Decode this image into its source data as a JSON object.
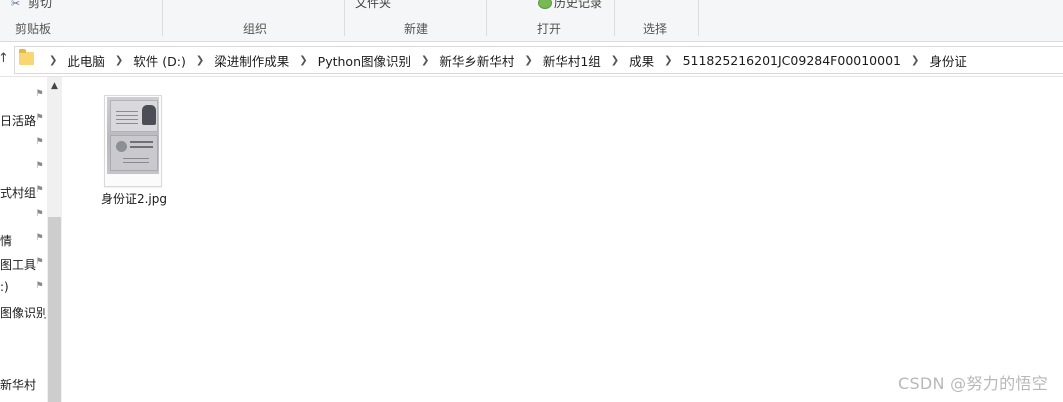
{
  "ribbon": {
    "cut_label": "剪切",
    "new_folder_label": "文件夹",
    "history_label": "历史记录",
    "groups": {
      "clipboard": "剪贴板",
      "organize": "组织",
      "new": "新建",
      "open": "打开",
      "select": "选择"
    }
  },
  "address_bar": {
    "breadcrumbs": [
      "此电脑",
      "软件 (D:)",
      "梁进制作成果",
      "Python图像识别",
      "新华乡新华村",
      "新华村1组",
      "成果",
      "511825216201JC09284F00010001",
      "身份证"
    ]
  },
  "nav_pane": {
    "items": [
      {
        "label": "",
        "pinned": true
      },
      {
        "label": "日活路",
        "pinned": true
      },
      {
        "label": "",
        "pinned": true
      },
      {
        "label": "",
        "pinned": true
      },
      {
        "label": "式村组",
        "pinned": true
      },
      {
        "label": "",
        "pinned": true
      },
      {
        "label": "情",
        "pinned": true
      },
      {
        "label": "图工具",
        "pinned": true
      },
      {
        "label": ":)",
        "pinned": true
      },
      {
        "label": "图像识别",
        "pinned": false
      },
      {
        "label": "新华村",
        "pinned": false
      }
    ]
  },
  "files": [
    {
      "name": "身份证2.jpg",
      "icon": "image-thumbnail"
    }
  ],
  "watermark": "CSDN @努力的悟空",
  "icons": {
    "cut": "scissors-icon",
    "history": "history-icon",
    "up": "up-arrow-icon",
    "folder": "folder-icon",
    "pin": "pin-icon",
    "chevron": "chevron-right-icon"
  }
}
